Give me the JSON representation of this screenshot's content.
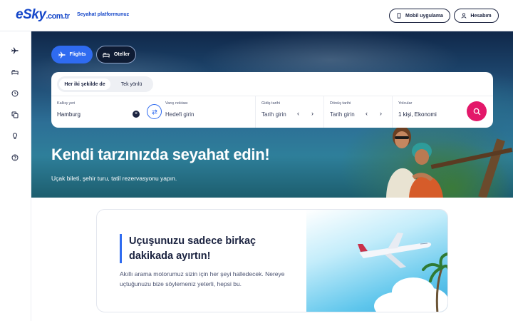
{
  "header": {
    "logo_main": "Sky",
    "logo_e": "e",
    "logo_suffix": ".com.tr",
    "tagline": "Seyahat platformunuz",
    "mobile_app_label": "Mobil uygulama",
    "account_label": "Hesabım"
  },
  "sidebar": {
    "items": [
      {
        "icon": "airplane-icon"
      },
      {
        "icon": "bed-icon"
      },
      {
        "icon": "clock-icon"
      },
      {
        "icon": "copy-icon"
      },
      {
        "icon": "lightbulb-icon"
      },
      {
        "icon": "help-icon"
      }
    ]
  },
  "search": {
    "tabs": [
      {
        "label": "Flights",
        "icon": "airplane-icon",
        "active": true
      },
      {
        "label": "Oteller",
        "icon": "bed-icon",
        "active": false
      }
    ],
    "trip_types": [
      {
        "label": "Her iki şekilde de",
        "selected": true
      },
      {
        "label": "Tek yönlü",
        "selected": false
      }
    ],
    "origin": {
      "label": "Kalkış yeri",
      "value": "Hamburg"
    },
    "destination": {
      "label": "Varış noktası",
      "placeholder": "Hedefi girin"
    },
    "departure": {
      "label": "Gidiş tarihi",
      "placeholder": "Tarih girin"
    },
    "return": {
      "label": "Dönüş tarihi",
      "placeholder": "Tarih girin"
    },
    "passengers": {
      "label": "Yolcular",
      "value": "1 kişi, Ekonomi"
    },
    "prev_glyph": "‹",
    "next_glyph": "›",
    "clear_glyph": "×"
  },
  "hero": {
    "title": "Kendi tarzınızda seyahat edin!",
    "subtitle": "Uçak bileti, şehir turu, tatil rezervasyonu yapın."
  },
  "promo": {
    "title": "Uçuşunuzu sadece birkaç dakikada ayırtın!",
    "text": "Akıllı arama motorumuz sizin için her şeyi halledecek. Nereye uçtuğunuzu bize söylemeniz yeterli, hepsi bu."
  },
  "colors": {
    "brand_blue": "#1547c9",
    "accent_blue": "#2f6bf0",
    "search_pink": "#e3186a",
    "ink": "#1b2340"
  }
}
